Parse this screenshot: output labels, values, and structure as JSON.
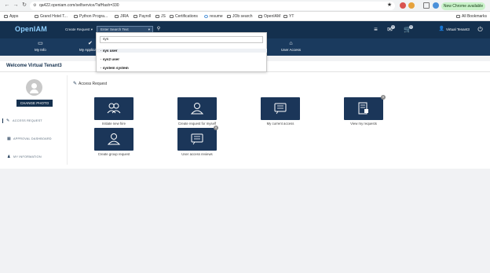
{
  "browser": {
    "url": "qa422.openiam.com/selfservice/?afHash=330",
    "chrome_pill": "New Chrome available",
    "bookmarks": [
      "Apps",
      "Grand Hotel T...",
      "Python Progra...",
      "JIRA",
      "Payroll",
      "JS",
      "Certifications",
      "resume",
      "JOb search",
      "OpenIAM",
      "YT"
    ],
    "all_bookmarks": "All Bookmarks"
  },
  "header": {
    "logo": "OpenIAM",
    "create_request": "Create Request",
    "search_placeholder": "Enter Search Text",
    "user_name": "Virtual Tenant3",
    "mail_badge": "0",
    "cart_badge": "0"
  },
  "subnav": {
    "my_info": "My Info",
    "my_applications": "My Applicati...",
    "user_access": "User Access"
  },
  "dropdown": {
    "query": "sys",
    "results": [
      "sys user",
      "sys2 user",
      "system system"
    ]
  },
  "welcome": "Welcome Virtual Tenant3",
  "sidebar": {
    "change_photo": "CHANGE PHOTO",
    "items": [
      "ACCESS REQUEST",
      "APPROVAL DASHBOARD",
      "MY INFORMATION"
    ]
  },
  "main": {
    "section_title": "Access Request",
    "tiles": [
      "Initiate new hire",
      "Create request for myself",
      "My current access",
      "View my requests",
      "Create group request",
      "User access reviews"
    ]
  }
}
